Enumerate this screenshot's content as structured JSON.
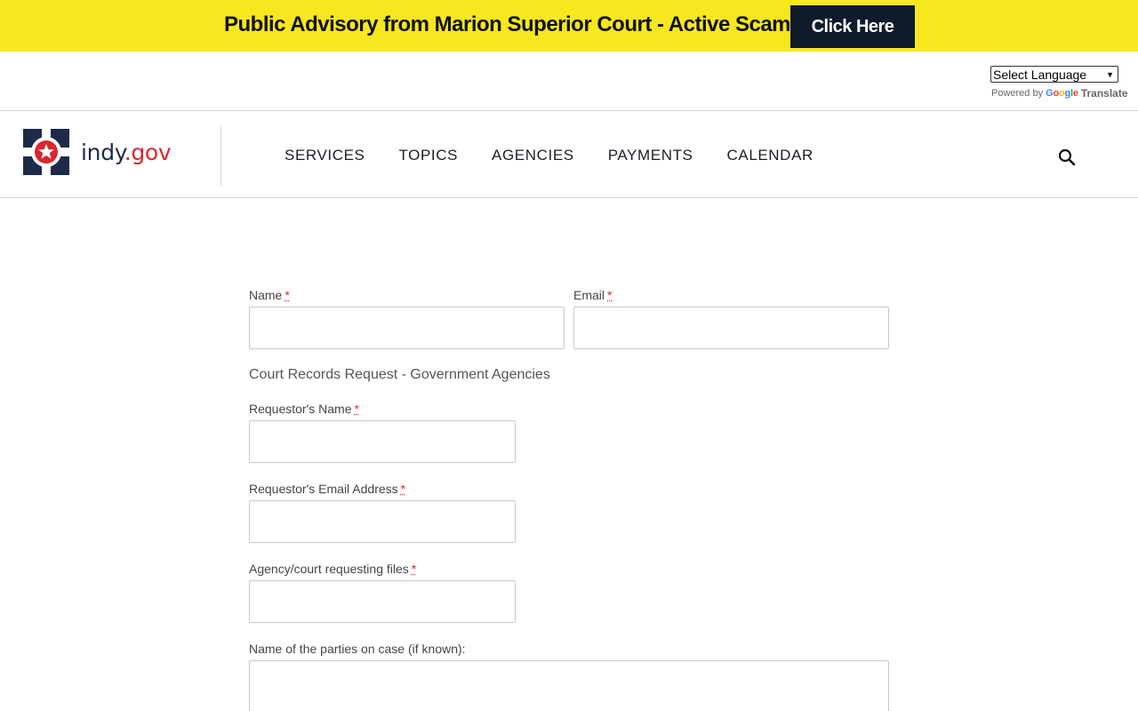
{
  "advisory": {
    "text": "Public Advisory from Marion Superior Court - Active Scams",
    "button_label": "Click Here",
    "bg_color": "#f6e71f",
    "button_color": "#0f1a2b"
  },
  "translate": {
    "select_value": "Select Language",
    "powered_by": "Powered by",
    "google_letters": [
      "G",
      "o",
      "o",
      "g",
      "l",
      "e"
    ],
    "translate_label": "Translate"
  },
  "header": {
    "logo_text_main": "indy",
    "logo_text_dot": ".gov",
    "nav": [
      "SERVICES",
      "TOPICS",
      "AGENCIES",
      "PAYMENTS",
      "CALENDAR"
    ],
    "search_icon": "search-icon",
    "brand_navy": "#1e2a4a",
    "brand_red": "#d9272e"
  },
  "form": {
    "name_label": "Name",
    "email_label": "Email",
    "section_heading": "Court Records Request - Government Agencies",
    "requestor_name_label": "Requestor's Name",
    "requestor_email_label": "Requestor's Email Address",
    "agency_label": "Agency/court requesting files",
    "parties_label": "Name of the parties on case (if known):",
    "required_marker": "*"
  }
}
